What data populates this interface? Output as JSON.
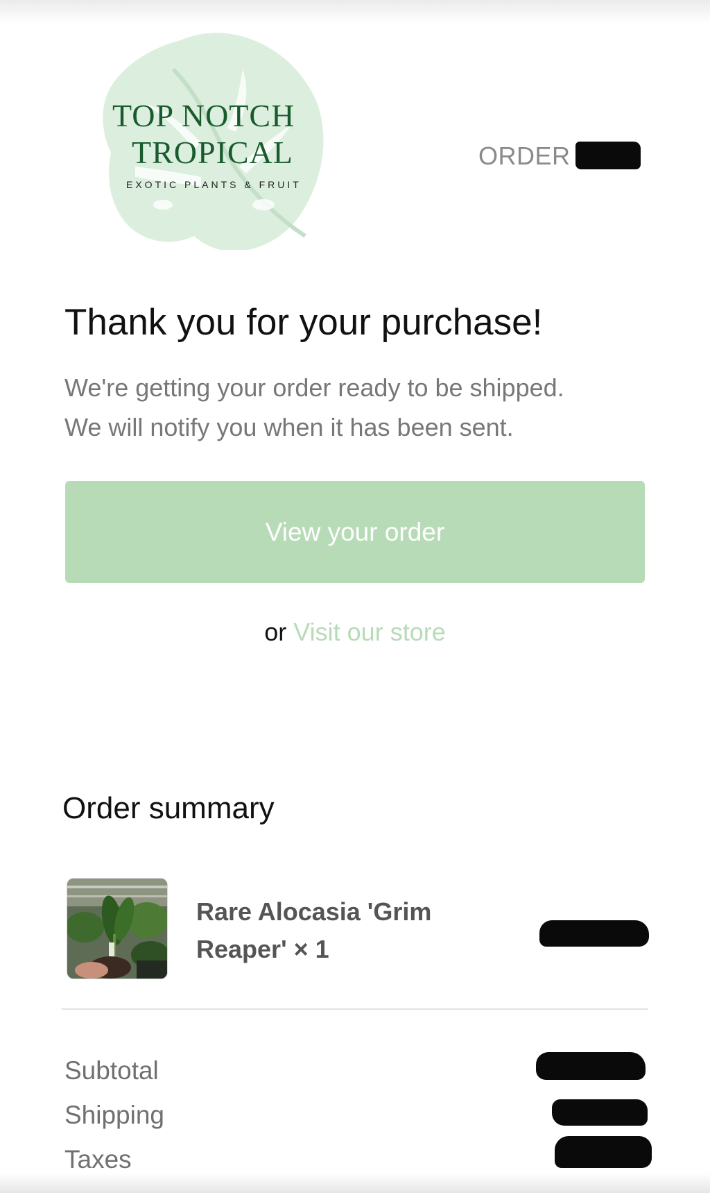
{
  "header": {
    "logo": {
      "line1": "TOP NOTCH",
      "line2": "TROPICAL",
      "tagline": "EXOTIC PLANTS & FRUIT",
      "icon": "monstera-leaf-icon"
    },
    "order_label": "ORDER #",
    "order_number_redacted": true
  },
  "main": {
    "heading": "Thank you for your purchase!",
    "message_line1": "We're getting your order ready to be shipped.",
    "message_line2": "We will notify you when it has been sent.",
    "view_order_button": "View your order",
    "or_text": "or",
    "store_link": "Visit our store"
  },
  "summary": {
    "title": "Order summary",
    "items": [
      {
        "name_line1": "Rare Alocasia 'Grim",
        "name_line2": "Reaper' × 1",
        "thumbnail": "plant-photo",
        "price_redacted": true
      }
    ],
    "rows": [
      {
        "label": "Subtotal",
        "value_redacted": true
      },
      {
        "label": "Shipping",
        "value_redacted": true
      },
      {
        "label": "Taxes",
        "value_redacted": true
      }
    ]
  },
  "colors": {
    "brand_green": "#1a5b2e",
    "leaf_mint": "#d6ecd9",
    "button_bg": "#b8dbb7",
    "link": "#b8dbb7",
    "muted_text": "#777777"
  }
}
